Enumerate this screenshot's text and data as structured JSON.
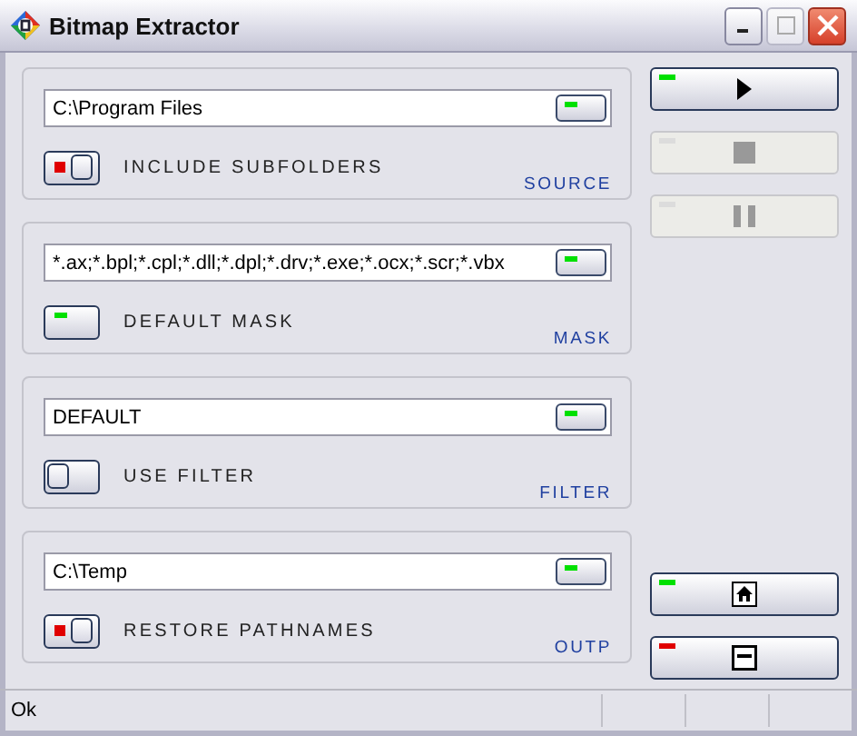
{
  "window": {
    "title": "Bitmap Extractor"
  },
  "sections": [
    {
      "value": "C:\\Program Files",
      "option": {
        "kind": "switch",
        "on": true,
        "label": "INCLUDE SUBFOLDERS"
      },
      "label": "SOURCE"
    },
    {
      "value": "*.ax;*.bpl;*.cpl;*.dll;*.dpl;*.drv;*.exe;*.ocx;*.scr;*.vbx",
      "option": {
        "kind": "button",
        "on": true,
        "label": "DEFAULT MASK"
      },
      "label": "MASK"
    },
    {
      "value": "DEFAULT",
      "option": {
        "kind": "switch",
        "on": false,
        "label": "USE FILTER"
      },
      "label": "FILTER"
    },
    {
      "value": "C:\\Temp",
      "option": {
        "kind": "switch",
        "on": true,
        "label": "RESTORE PATHNAMES"
      },
      "label": "OUTP"
    }
  ],
  "controls": [
    {
      "kind": "play",
      "disabled": false,
      "color": "#00e000"
    },
    {
      "kind": "stop",
      "disabled": true
    },
    {
      "kind": "pause",
      "disabled": true
    },
    {
      "kind": "home",
      "disabled": false,
      "color": "#00e000"
    },
    {
      "kind": "minimize",
      "disabled": false,
      "color": "#e00000"
    }
  ],
  "status_bar": {
    "text": "Ok"
  }
}
